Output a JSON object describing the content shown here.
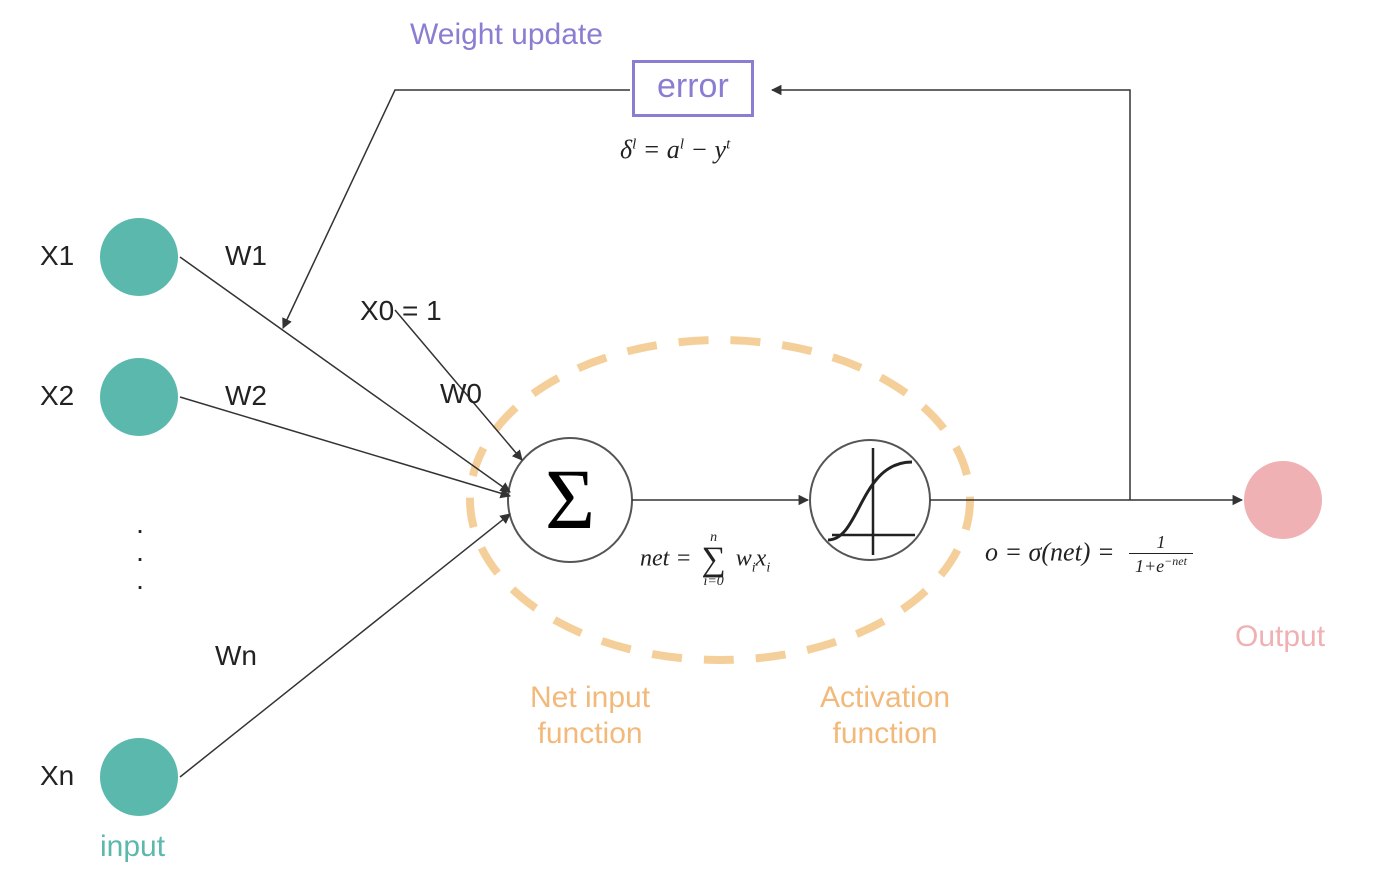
{
  "inputs": {
    "x1": "X1",
    "x2": "X2",
    "xn": "Xn",
    "label": "input"
  },
  "weights": {
    "w1": "W1",
    "w2": "W2",
    "wn": "Wn",
    "w0": "W0",
    "bias": "X0 = 1"
  },
  "error": {
    "title": "Weight update",
    "box": "error",
    "formula_delta": "δ",
    "formula_sup_l1": "l",
    "formula_eq": " = a",
    "formula_sup_l2": "l",
    "formula_minus": " − y",
    "formula_sup_t": "t"
  },
  "net": {
    "label1": "Net input",
    "label2": "function",
    "formula_lhs": "net  =",
    "sum_top": "n",
    "sum_bottom": "i=0",
    "sum_body": "w",
    "sum_sub_i1": "i",
    "sum_x": "x",
    "sum_sub_i2": "i"
  },
  "activation": {
    "label1": "Activation",
    "label2": "function",
    "formula": "o  =  σ(net)  =",
    "frac_top": "1",
    "frac_bot_a": "1+e",
    "frac_bot_exp": "−net"
  },
  "output": {
    "label": "Output"
  },
  "icons": {
    "sigma": "Σ"
  }
}
